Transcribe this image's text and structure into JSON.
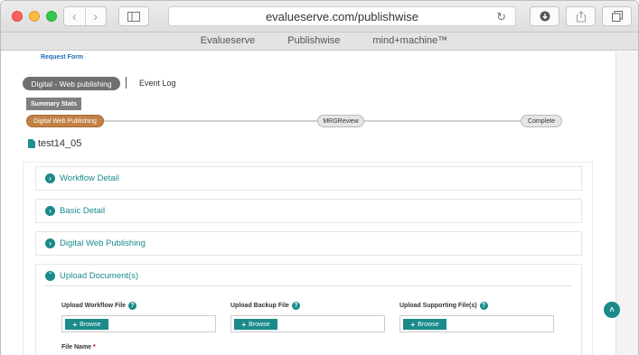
{
  "browser": {
    "url": "evalueserve.com/publishwise",
    "favorites": [
      "Evalueserve",
      "Publishwise",
      "mind+machine™"
    ]
  },
  "page": {
    "request_form_label": "Request Form",
    "active_tab": "Digital - Web publishing",
    "event_log_tab": "Event Log",
    "summary_stats": "Summary Stats",
    "stages": [
      "Digital Web Publishing",
      "MRGReview",
      "Complete"
    ],
    "current_stage_color": "#c28245",
    "document_title": "test14_05",
    "sections": [
      "Workflow Detail",
      "Basic Detail",
      "Digital Web Publishing",
      "Upload Document(s)"
    ],
    "uploads": {
      "workflow_label": "Upload Workflow File",
      "backup_label": "Upload Backup File",
      "supporting_label": "Upload Supporting File(s)",
      "browse_label": "Browse"
    },
    "file_name_label": "File Name",
    "required_mark": "*",
    "accent_color": "#1a8a8a"
  }
}
